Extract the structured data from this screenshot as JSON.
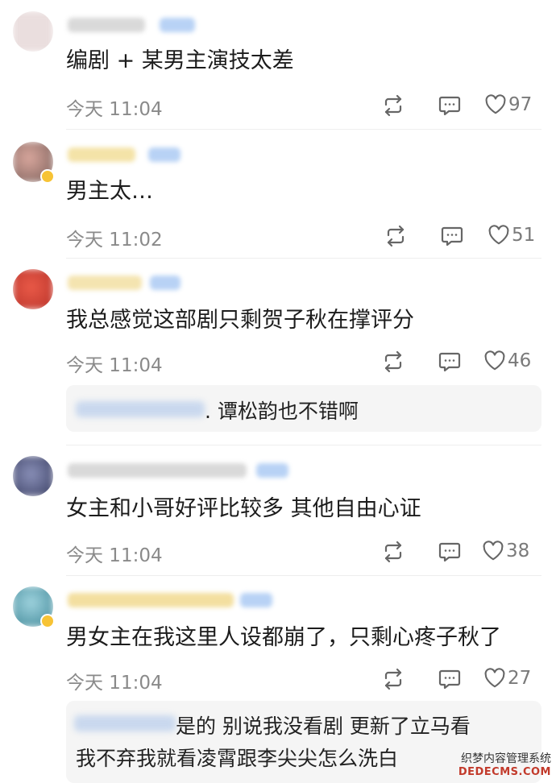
{
  "comments": [
    {
      "text": "编剧 + 某男主演技太差",
      "time": "今天 11:04",
      "likes": "97"
    },
    {
      "text": "男主太…",
      "time": "今天 11:02",
      "likes": "51"
    },
    {
      "text": "我总感觉这部剧只剩贺子秋在撑评分",
      "time": "今天 11:04",
      "likes": "46",
      "reply": {
        "text": ". 谭松韵也不错啊"
      }
    },
    {
      "text": "女主和小哥好评比较多 其他自由心证",
      "time": "今天 11:04",
      "likes": "38"
    },
    {
      "text": "男女主在我这里人设都崩了，只剩心疼子秋了",
      "time": "今天 11:04",
      "likes": "27",
      "reply": {
        "line1": "是的  别说我没看剧  更新了立马看",
        "line2": "我不弃我就看凌霄跟李尖尖怎么洗白"
      }
    }
  ],
  "watermark": {
    "line1": "织梦内容管理系统",
    "line2": "DEDECMS.COM"
  },
  "icons": {
    "repost": "repost-icon",
    "comment": "comment-icon",
    "like": "heart-icon"
  },
  "colors": {
    "avatar1": "#eadede",
    "avatar2": "#c98f86",
    "avatar3": "#e04a3a",
    "avatar4": "#4d5a8a",
    "avatar5": "#6fb8c9"
  }
}
